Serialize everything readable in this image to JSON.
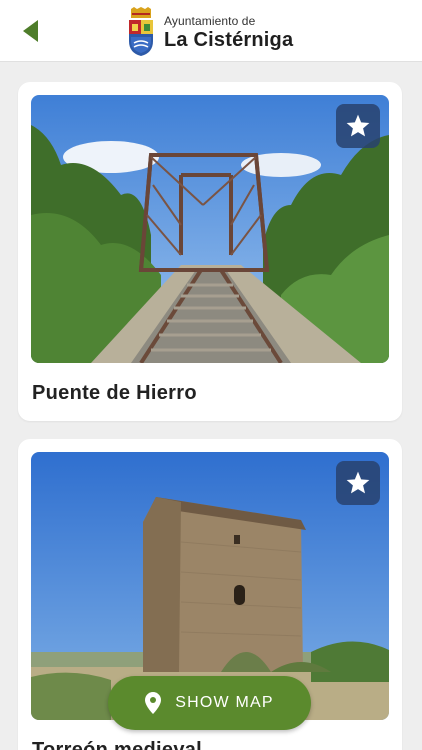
{
  "header": {
    "back_icon": "back-arrow-icon",
    "brand_line1": "Ayuntamiento de",
    "brand_line2": "La Cistérniga",
    "accent": "#4e7d2a"
  },
  "places": [
    {
      "title": "Puente de Hierro",
      "favorite_icon": "star-icon"
    },
    {
      "title": "Torreón medieval",
      "favorite_icon": "star-icon"
    }
  ],
  "show_map": {
    "label": "SHOW MAP",
    "icon": "map-pin-icon",
    "color": "#5b8a2d"
  }
}
